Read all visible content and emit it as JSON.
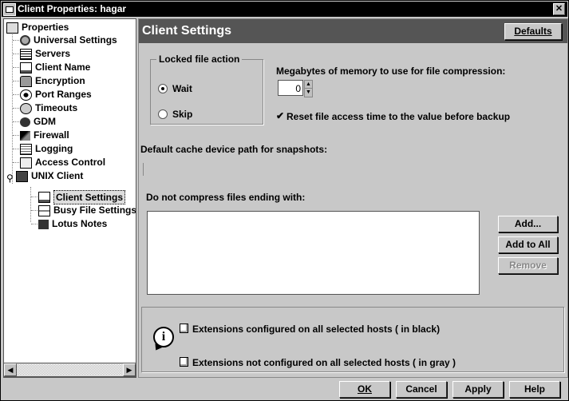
{
  "window": {
    "title": "Client Properties: hagar",
    "close_symbol": "✕"
  },
  "tree": {
    "root": "Properties",
    "items": [
      {
        "label": "Universal Settings",
        "icon": "gear-icon"
      },
      {
        "label": "Servers",
        "icon": "server-icon"
      },
      {
        "label": "Client Name",
        "icon": "computer-icon"
      },
      {
        "label": "Encryption",
        "icon": "lock-icon"
      },
      {
        "label": "Port Ranges",
        "icon": "port-icon"
      },
      {
        "label": "Timeouts",
        "icon": "clock-icon"
      },
      {
        "label": "GDM",
        "icon": "gdm-icon"
      },
      {
        "label": "Firewall",
        "icon": "firewall-icon"
      },
      {
        "label": "Logging",
        "icon": "logging-icon"
      },
      {
        "label": "Access Control",
        "icon": "access-control-icon"
      },
      {
        "label": "UNIX Client",
        "icon": "unix-client-icon"
      }
    ],
    "children": [
      {
        "label": "Client Settings",
        "icon": "client-settings-icon",
        "selected": true
      },
      {
        "label": "Busy File Settings",
        "icon": "busy-file-icon"
      },
      {
        "label": "Lotus Notes",
        "icon": "lotus-notes-icon"
      }
    ]
  },
  "panel": {
    "title": "Client Settings",
    "defaults_button": "Defaults",
    "locked_group_title": "Locked file action",
    "radio_wait": "Wait",
    "radio_skip": "Skip",
    "radio_selected": "Wait",
    "memory_label": "Megabytes of memory to use for file compression:",
    "memory_value": "0",
    "reset_access_label": "Reset file access time to the value before backup",
    "reset_access_checked": true,
    "cache_path_label": "Default cache device path for snapshots:",
    "cache_path_value": "",
    "no_compress_label": "Do not compress files ending with:",
    "add_button": "Add...",
    "add_to_all_button": "Add to All",
    "remove_button": "Remove",
    "legend_black": "Extensions configured on all selected hosts ( in black)",
    "legend_gray": "Extensions not configured on all selected hosts ( in gray )"
  },
  "footer": {
    "ok": "OK",
    "cancel": "Cancel",
    "apply": "Apply",
    "help": "Help"
  }
}
